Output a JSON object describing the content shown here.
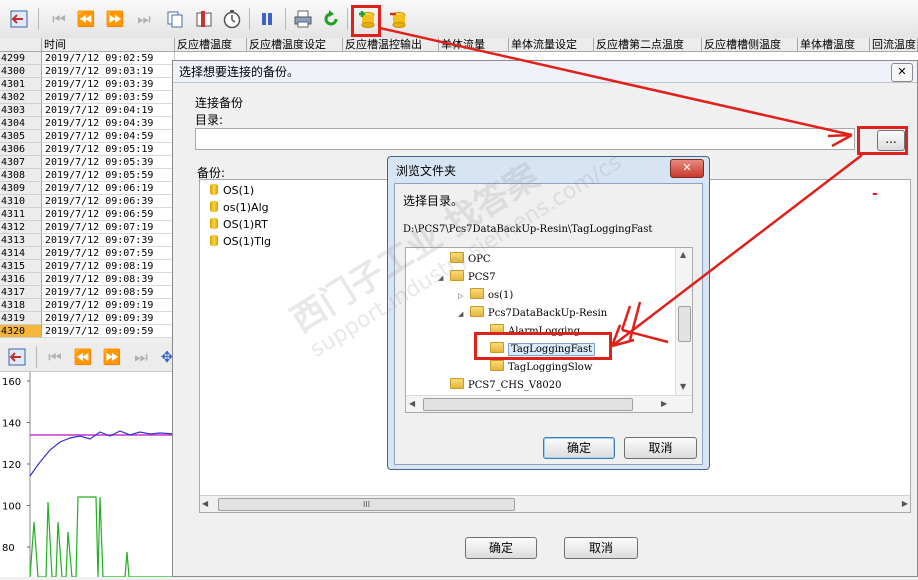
{
  "table": {
    "headers": [
      "时间",
      "反应槽温度",
      "反应槽温度设定",
      "反应槽温控输出",
      "单体流量",
      "单体流量设定",
      "反应槽第二点温度",
      "反应槽槽侧温度",
      "单体槽温度",
      "回流温度"
    ],
    "rows": [
      {
        "n": "4299",
        "t": "2019/7/12 09:02:59"
      },
      {
        "n": "4300",
        "t": "2019/7/12 09:03:19"
      },
      {
        "n": "4301",
        "t": "2019/7/12 09:03:39"
      },
      {
        "n": "4302",
        "t": "2019/7/12 09:03:59"
      },
      {
        "n": "4303",
        "t": "2019/7/12 09:04:19"
      },
      {
        "n": "4304",
        "t": "2019/7/12 09:04:39"
      },
      {
        "n": "4305",
        "t": "2019/7/12 09:04:59"
      },
      {
        "n": "4306",
        "t": "2019/7/12 09:05:19"
      },
      {
        "n": "4307",
        "t": "2019/7/12 09:05:39"
      },
      {
        "n": "4308",
        "t": "2019/7/12 09:05:59"
      },
      {
        "n": "4309",
        "t": "2019/7/12 09:06:19"
      },
      {
        "n": "4310",
        "t": "2019/7/12 09:06:39"
      },
      {
        "n": "4311",
        "t": "2019/7/12 09:06:59"
      },
      {
        "n": "4312",
        "t": "2019/7/12 09:07:19"
      },
      {
        "n": "4313",
        "t": "2019/7/12 09:07:39"
      },
      {
        "n": "4314",
        "t": "2019/7/12 09:07:59"
      },
      {
        "n": "4315",
        "t": "2019/7/12 09:08:19"
      },
      {
        "n": "4316",
        "t": "2019/7/12 09:08:39"
      },
      {
        "n": "4317",
        "t": "2019/7/12 09:08:59"
      },
      {
        "n": "4318",
        "t": "2019/7/12 09:09:19"
      },
      {
        "n": "4319",
        "t": "2019/7/12 09:09:39"
      },
      {
        "n": "4320",
        "t": "2019/7/12 09:09:59"
      }
    ],
    "selected_row": "4320"
  },
  "trend": {
    "y_ticks": [
      "160",
      "140",
      "120",
      "100",
      "80"
    ],
    "colors": {
      "setpoint": "#cc33cc",
      "temp": "#3030d0",
      "flow": "#20b020"
    }
  },
  "dialog_connect": {
    "title": "选择想要连接的备份。",
    "close_glyph": "✕",
    "group_label": "连接备份",
    "dir_label": "目录:",
    "browse_button": "...",
    "backup_label": "备份:",
    "backups": [
      "OS(1)",
      "os(1)Alg",
      "OS(1)RT",
      "OS(1)Tlg"
    ],
    "ok": "确定",
    "cancel": "取消",
    "hscroll_glyph": "III",
    "stray_mark": "-"
  },
  "dialog_browse": {
    "title": "浏览文件夹",
    "close_glyph": "✕",
    "prompt": "选择目录。",
    "path": "D:\\PCS7\\Pcs7DataBackUp-Resin\\TagLoggingFast",
    "tree": [
      {
        "label": "OPC",
        "level": 1,
        "exp": ""
      },
      {
        "label": "PCS7",
        "level": 1,
        "exp": "◢"
      },
      {
        "label": "os(1)",
        "level": 2,
        "exp": "▷"
      },
      {
        "label": "Pcs7DataBackUp-Resin",
        "level": 2,
        "exp": "◢"
      },
      {
        "label": "AlarmLogging",
        "level": 3,
        "exp": ""
      },
      {
        "label": "TagLoggingFast",
        "level": 3,
        "exp": ""
      },
      {
        "label": "TagLoggingSlow",
        "level": 3,
        "exp": ""
      },
      {
        "label": "PCS7_CHS_V8020",
        "level": 1,
        "exp": ""
      }
    ],
    "selected": "TagLoggingFast",
    "ok": "确定",
    "cancel": "取消"
  },
  "watermark": {
    "line1": "西门子工业 找答案",
    "line2": "support.industry.siemens.com/cs"
  },
  "annotation_color": "#e0201a"
}
